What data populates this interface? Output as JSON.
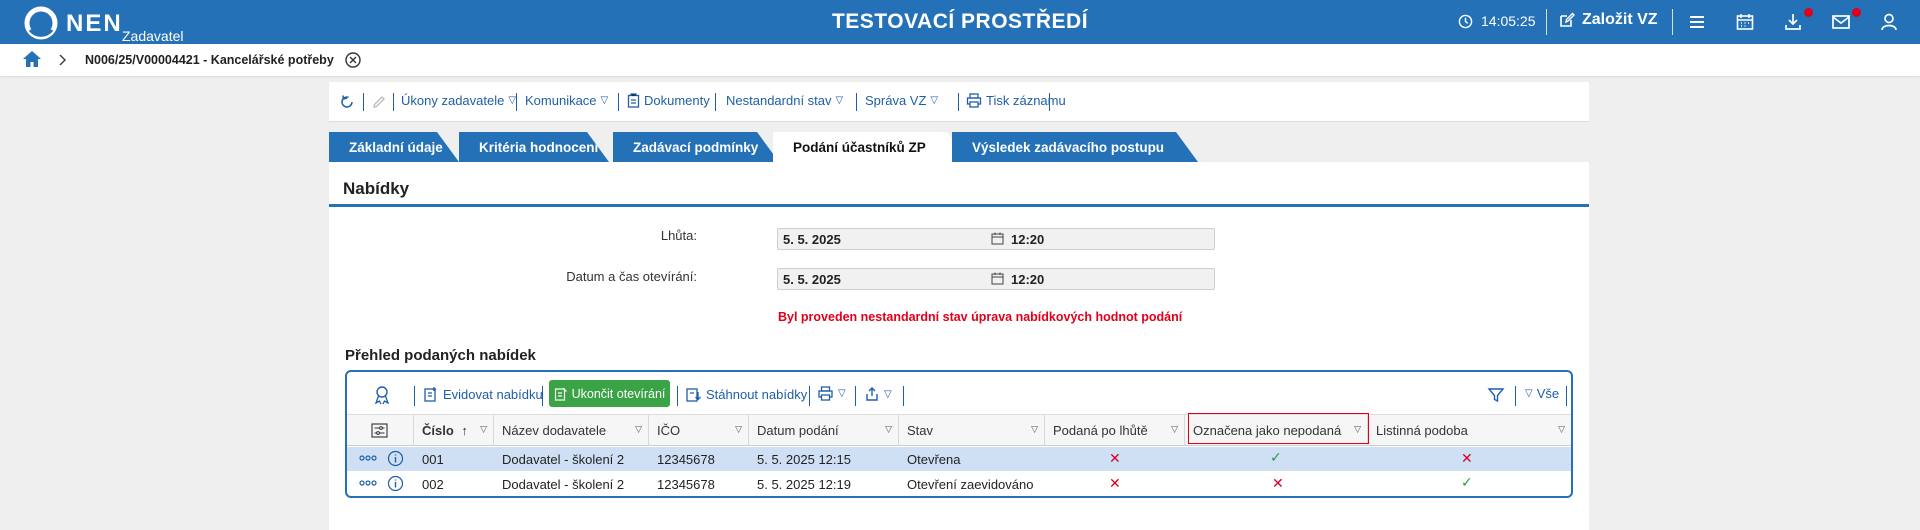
{
  "topbar": {
    "logo_text": "NEN",
    "logo_sub": "Zadavatel",
    "env_title": "TESTOVACÍ PROSTŘEDÍ",
    "clock": "14:05:25",
    "create_vz_label": "Založit VZ",
    "colors": {
      "bar": "#2471b8",
      "notification_dot": "#e1001a"
    }
  },
  "breadcrumb": {
    "current": "N006/25/V00004421 - Kancelářské potřeby"
  },
  "actions": {
    "ukony": "Úkony zadavatele",
    "komunikace": "Komunikace",
    "dokumenty": "Dokumenty",
    "nestandardni": "Nestandardní stav",
    "sprava": "Správa VZ",
    "tisk": "Tisk záznamu"
  },
  "tabs": [
    {
      "label": "Základní údaje",
      "active": false
    },
    {
      "label": "Kritéria hodnocení",
      "active": false
    },
    {
      "label": "Zadávací podmínky",
      "active": false
    },
    {
      "label": "Podání účastníků ZP",
      "active": true
    },
    {
      "label": "Výsledek zadávacího postupu",
      "active": false
    }
  ],
  "panel": {
    "title": "Nabídky",
    "lhuta_label": "Lhůta:",
    "lhuta_date": "5. 5. 2025",
    "lhuta_time": "12:20",
    "otevirani_label": "Datum a čas otevírání:",
    "otevirani_date": "5. 5. 2025",
    "otevirani_time": "12:20",
    "warning": "Byl proveden nestandardní stav úprava nabídkových hodnot podání",
    "section_title": "Přehled podaných nabídek"
  },
  "grid_toolbar": {
    "evidovat": "Evidovat nabídku",
    "ukoncit": "Ukončit otevírání",
    "stahnout": "Stáhnout nabídky",
    "vse": "Vše"
  },
  "columns": [
    "Číslo",
    "Název dodavatele",
    "IČO",
    "Datum podání",
    "Stav",
    "Podaná po lhůtě",
    "Označena jako nepodaná",
    "Listinná podoba"
  ],
  "rows": [
    {
      "cislo": "001",
      "nazev": "Dodavatel - školení 2",
      "ico": "12345678",
      "datum": "5. 5. 2025 12:15",
      "stav": "Otevřena",
      "po_lhute": "✕",
      "nepodana": "✓",
      "listinna": "✕"
    },
    {
      "cislo": "002",
      "nazev": "Dodavatel - školení 2",
      "ico": "12345678",
      "datum": "5. 5. 2025 12:19",
      "stav": "Otevření zaevidováno",
      "po_lhute": "✕",
      "nepodana": "✕",
      "listinna": "✓"
    }
  ]
}
